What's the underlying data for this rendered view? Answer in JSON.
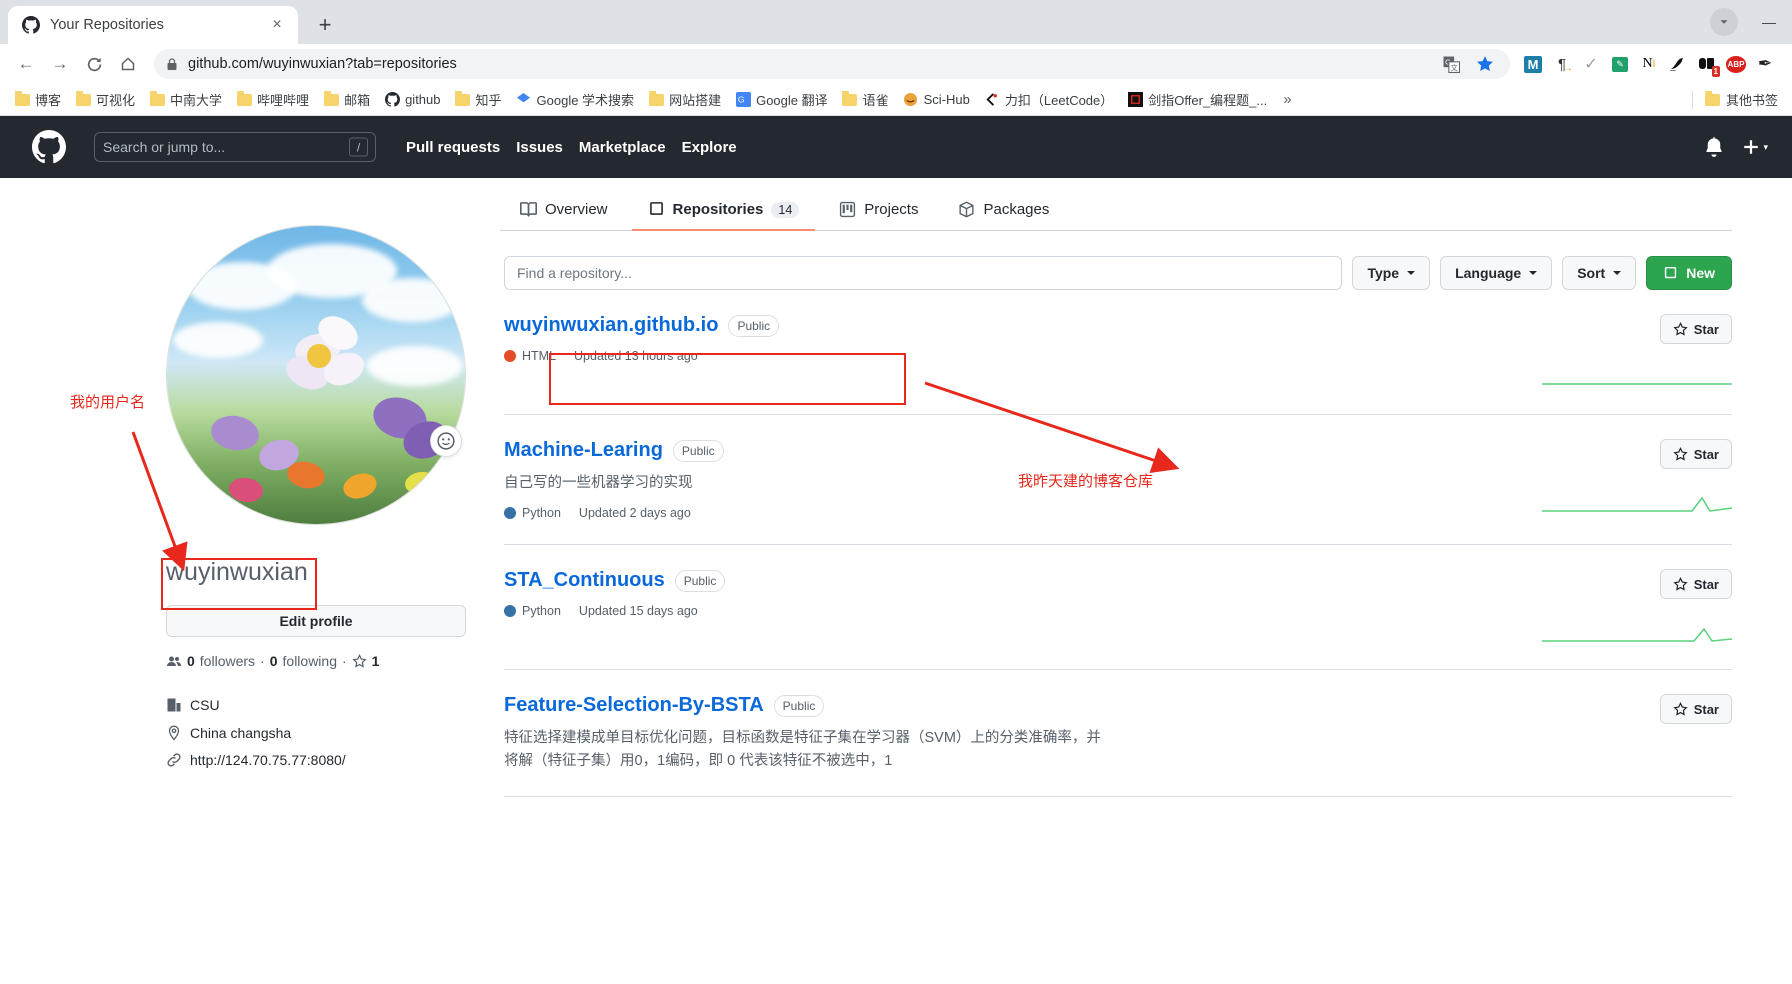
{
  "browser": {
    "tab": {
      "title": "Your Repositories",
      "favicon": "github-icon",
      "close": "×"
    },
    "new_tab_label": "+",
    "window_controls": {
      "minimize": "—",
      "maximize": "▢",
      "close": "✕"
    },
    "nav": {
      "back": "←",
      "forward": "→",
      "reload": "C",
      "home": "⌂"
    },
    "address": {
      "url": "github.com/wuyinwuxian?tab=repositories",
      "lock": "lock-icon"
    },
    "extensions": [
      {
        "name": "translate-icon",
        "glyph": "G"
      },
      {
        "name": "bookmark-star-icon",
        "glyph": "★"
      },
      {
        "name": "m-extension-icon",
        "glyph": "M"
      },
      {
        "name": "pilcrow-extension-icon",
        "glyph": "¶"
      },
      {
        "name": "checkmark-extension-icon",
        "glyph": "✓"
      },
      {
        "name": "green-note-icon",
        "glyph": "▦"
      },
      {
        "name": "n-extension-icon",
        "glyph": "N"
      },
      {
        "name": "bird-extension-icon",
        "glyph": "🐦"
      },
      {
        "name": "dark-extension-icon",
        "glyph": "◧",
        "badge": "1"
      },
      {
        "name": "adblock-plus-icon",
        "glyph": "ABP"
      },
      {
        "name": "feather-extension-icon",
        "glyph": "✒"
      }
    ],
    "bookmarks": [
      {
        "label": "博客",
        "icon": "folder-icon"
      },
      {
        "label": "可视化",
        "icon": "folder-icon"
      },
      {
        "label": "中南大学",
        "icon": "folder-icon"
      },
      {
        "label": "哔哩哔哩",
        "icon": "folder-icon"
      },
      {
        "label": "邮箱",
        "icon": "folder-icon"
      },
      {
        "label": "github",
        "icon": "github-icon"
      },
      {
        "label": "知乎",
        "icon": "folder-icon"
      },
      {
        "label": "Google 学术搜索",
        "icon": "google-scholar-icon"
      },
      {
        "label": "网站搭建",
        "icon": "folder-icon"
      },
      {
        "label": "Google 翻译",
        "icon": "google-translate-icon"
      },
      {
        "label": "语雀",
        "icon": "folder-icon"
      },
      {
        "label": "Sci-Hub",
        "icon": "scihub-icon"
      },
      {
        "label": "力扣（LeetCode）",
        "icon": "leetcode-icon"
      },
      {
        "label": "剑指Offer_编程题_...",
        "icon": "nowcoder-icon"
      }
    ],
    "bookmarks_overflow": "»",
    "other_bookmarks": {
      "label": "其他书签",
      "icon": "folder-icon"
    }
  },
  "github_header": {
    "logo": "github-mark-icon",
    "search_placeholder": "Search or jump to...",
    "search_shortcut": "/",
    "nav": [
      {
        "label": "Pull requests"
      },
      {
        "label": "Issues"
      },
      {
        "label": "Marketplace"
      },
      {
        "label": "Explore"
      }
    ],
    "notifications_icon": "bell-icon",
    "create_new_icon": "plus-icon",
    "create_new_caret": "▾"
  },
  "profile": {
    "avatar_alt": "user-avatar",
    "emoji_button": "set-status-emoji",
    "username": "wuyinwuxian",
    "edit_profile_label": "Edit profile",
    "followers_count": "0",
    "followers_label": "followers",
    "following_count": "0",
    "following_label": "following",
    "stars_count": "1",
    "separator": "·",
    "details": [
      {
        "icon": "organization-icon",
        "text": "CSU"
      },
      {
        "icon": "location-icon",
        "text": "China changsha"
      },
      {
        "icon": "link-icon",
        "text": "http://124.70.75.77:8080/"
      }
    ]
  },
  "tabs": [
    {
      "label": "Overview",
      "icon": "book-icon",
      "active": false,
      "count": null
    },
    {
      "label": "Repositories",
      "icon": "repo-icon",
      "active": true,
      "count": "14"
    },
    {
      "label": "Projects",
      "icon": "project-icon",
      "active": false,
      "count": null
    },
    {
      "label": "Packages",
      "icon": "package-icon",
      "active": false,
      "count": null
    }
  ],
  "filters": {
    "find_placeholder": "Find a repository...",
    "type_label": "Type",
    "language_label": "Language",
    "sort_label": "Sort",
    "new_label": "New",
    "new_icon": "repo-icon",
    "caret": "▾"
  },
  "repositories": [
    {
      "name": "wuyinwuxian.github.io",
      "visibility": "Public",
      "description": "",
      "language": "HTML",
      "language_color": "#e34c26",
      "updated": "Updated 13 hours ago",
      "star_label": "Star",
      "sparkline": "flat"
    },
    {
      "name": "Machine-Learing",
      "visibility": "Public",
      "description": "自己写的一些机器学习的实现",
      "language": "Python",
      "language_color": "#3572A5",
      "updated": "Updated 2 days ago",
      "star_label": "Star",
      "sparkline": "rising-end"
    },
    {
      "name": "STA_Continuous",
      "visibility": "Public",
      "description": "",
      "language": "Python",
      "language_color": "#3572A5",
      "updated": "Updated 15 days ago",
      "star_label": "Star",
      "sparkline": "rising-end"
    },
    {
      "name": "Feature-Selection-By-BSTA",
      "visibility": "Public",
      "description": "特征选择建模成单目标优化问题，目标函数是特征子集在学习器（SVM）上的分类准确率，并将解（特征子集）用0，1编码，即 0 代表该特征不被选中，1",
      "language": "",
      "language_color": "",
      "updated": "",
      "star_label": "Star",
      "sparkline": "none"
    }
  ],
  "annotations": [
    {
      "name": "username-annotation",
      "text": "我的用户名",
      "color": "#e8281c"
    },
    {
      "name": "blog-repo-annotation",
      "text": "我昨天建的博客仓库",
      "color": "#e8281c"
    }
  ],
  "colors": {
    "github_header_bg": "#24292f",
    "link_blue": "#0969da",
    "green_button": "#2da44e",
    "active_tab_underline": "#fd8c73",
    "annotation_red": "#e8281c"
  }
}
